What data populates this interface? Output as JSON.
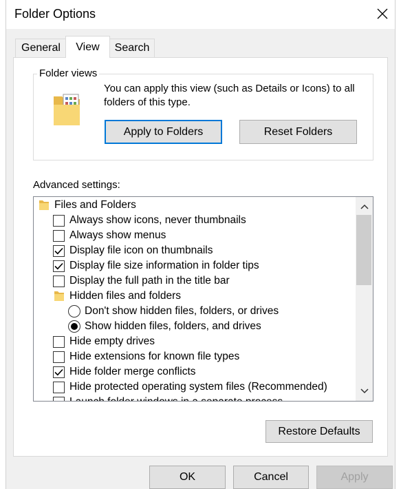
{
  "window": {
    "title": "Folder Options",
    "close_icon": "close-icon"
  },
  "tabs": [
    {
      "label": "General",
      "active": false
    },
    {
      "label": "View",
      "active": true
    },
    {
      "label": "Search",
      "active": false
    }
  ],
  "folder_views": {
    "title": "Folder views",
    "description": "You can apply this view (such as Details or Icons) to all folders of this type.",
    "icon": "folder-view-icon",
    "apply_button": "Apply to Folders",
    "reset_button": "Reset Folders"
  },
  "advanced": {
    "label": "Advanced settings:",
    "items": [
      {
        "type": "folder",
        "label": "Files and Folders"
      },
      {
        "type": "checkbox",
        "checked": false,
        "label": "Always show icons, never thumbnails"
      },
      {
        "type": "checkbox",
        "checked": false,
        "label": "Always show menus"
      },
      {
        "type": "checkbox",
        "checked": true,
        "label": "Display file icon on thumbnails"
      },
      {
        "type": "checkbox",
        "checked": true,
        "label": "Display file size information in folder tips"
      },
      {
        "type": "checkbox",
        "checked": false,
        "label": "Display the full path in the title bar"
      },
      {
        "type": "folder",
        "label": "Hidden files and folders"
      },
      {
        "type": "radio",
        "checked": false,
        "label": "Don't show hidden files, folders, or drives"
      },
      {
        "type": "radio",
        "checked": true,
        "label": "Show hidden files, folders, and drives"
      },
      {
        "type": "checkbox",
        "checked": false,
        "label": "Hide empty drives"
      },
      {
        "type": "checkbox",
        "checked": false,
        "label": "Hide extensions for known file types"
      },
      {
        "type": "checkbox",
        "checked": true,
        "label": "Hide folder merge conflicts"
      },
      {
        "type": "checkbox",
        "checked": false,
        "label": "Hide protected operating system files (Recommended)"
      },
      {
        "type": "checkbox",
        "checked": false,
        "label": "Launch folder windows in a separate process"
      }
    ]
  },
  "buttons": {
    "restore_defaults": "Restore Defaults",
    "ok": "OK",
    "cancel": "Cancel",
    "apply": "Apply"
  },
  "colors": {
    "focus_accent": "#0078d7",
    "folder_yellow": "#f8d775"
  }
}
